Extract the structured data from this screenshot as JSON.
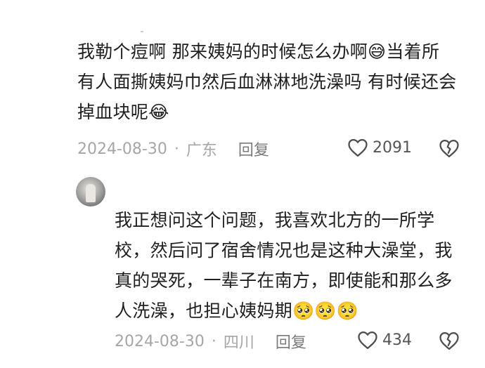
{
  "comment1": {
    "text": "我勒个痘啊 那来姨妈的时候怎么办啊😅当着所有人面撕姨妈巾然后血淋淋地洗澡吗 有时候还会掉血块呢😂",
    "date": "2024-08-30",
    "location": "广东",
    "reply_label": "回复",
    "likes": "2091"
  },
  "comment2": {
    "text": "我正想问这个问题，我喜欢北方的一所学校，然后问了宿舍情况也是这种大澡堂，我真的哭死，一辈子在南方，即使能和那么多人洗澡，也担心姨妈期🥺🥺🥺",
    "date": "2024-08-30",
    "location": "四川",
    "reply_label": "回复",
    "likes": "434"
  },
  "separator": "·",
  "icons": {
    "like": "heart-outline-icon",
    "dislike": "broken-heart-icon"
  }
}
